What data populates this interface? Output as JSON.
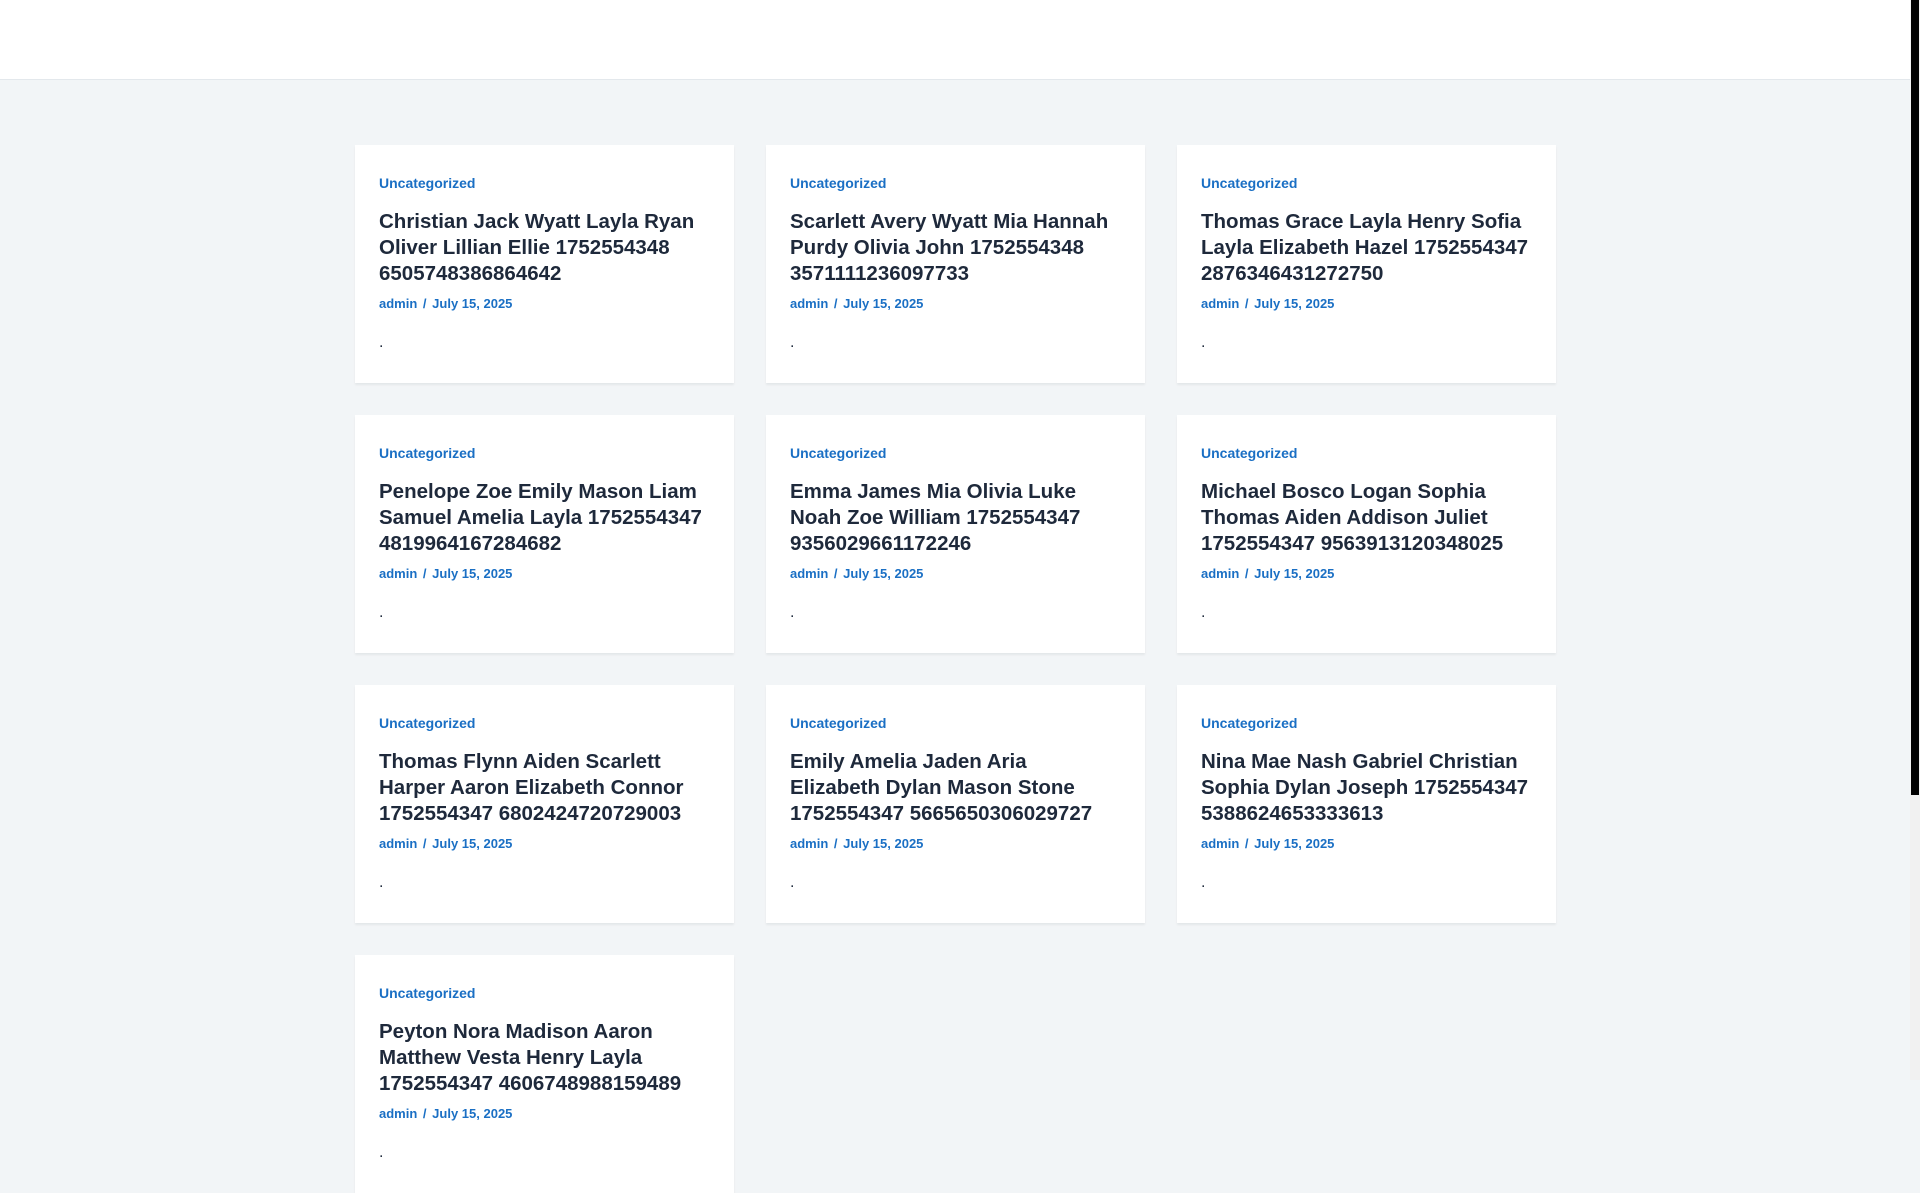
{
  "posts": [
    {
      "category": "Uncategorized",
      "title": "Christian Jack Wyatt Layla Ryan Oliver Lillian Ellie 1752554348 6505748386864642",
      "author": "admin",
      "separator": "/",
      "date": "July 15, 2025",
      "excerpt": "."
    },
    {
      "category": "Uncategorized",
      "title": "Scarlett Avery Wyatt Mia Hannah Purdy Olivia John 1752554348 3571111236097733",
      "author": "admin",
      "separator": "/",
      "date": "July 15, 2025",
      "excerpt": "."
    },
    {
      "category": "Uncategorized",
      "title": "Thomas Grace Layla Henry Sofia Layla Elizabeth Hazel 1752554347 2876346431272750",
      "author": "admin",
      "separator": "/",
      "date": "July 15, 2025",
      "excerpt": "."
    },
    {
      "category": "Uncategorized",
      "title": "Penelope Zoe Emily Mason Liam Samuel Amelia Layla 1752554347 4819964167284682",
      "author": "admin",
      "separator": "/",
      "date": "July 15, 2025",
      "excerpt": "."
    },
    {
      "category": "Uncategorized",
      "title": "Emma James Mia Olivia Luke Noah Zoe William 1752554347 9356029661172246",
      "author": "admin",
      "separator": "/",
      "date": "July 15, 2025",
      "excerpt": "."
    },
    {
      "category": "Uncategorized",
      "title": "Michael Bosco Logan Sophia Thomas Aiden Addison Juliet 1752554347 9563913120348025",
      "author": "admin",
      "separator": "/",
      "date": "July 15, 2025",
      "excerpt": "."
    },
    {
      "category": "Uncategorized",
      "title": "Thomas Flynn Aiden Scarlett Harper Aaron Elizabeth Connor 1752554347 6802424720729003",
      "author": "admin",
      "separator": "/",
      "date": "July 15, 2025",
      "excerpt": "."
    },
    {
      "category": "Uncategorized",
      "title": "Emily Amelia Jaden Aria Elizabeth Dylan Mason Stone 1752554347 5665650306029727",
      "author": "admin",
      "separator": "/",
      "date": "July 15, 2025",
      "excerpt": "."
    },
    {
      "category": "Uncategorized",
      "title": "Nina Mae Nash Gabriel Christian Sophia Dylan Joseph 1752554347 5388624653333613",
      "author": "admin",
      "separator": "/",
      "date": "July 15, 2025",
      "excerpt": "."
    },
    {
      "category": "Uncategorized",
      "title": "Peyton Nora Madison Aaron Matthew Vesta Henry Layla 1752554347 4606748988159489",
      "author": "admin",
      "separator": "/",
      "date": "July 15, 2025",
      "excerpt": "."
    }
  ]
}
